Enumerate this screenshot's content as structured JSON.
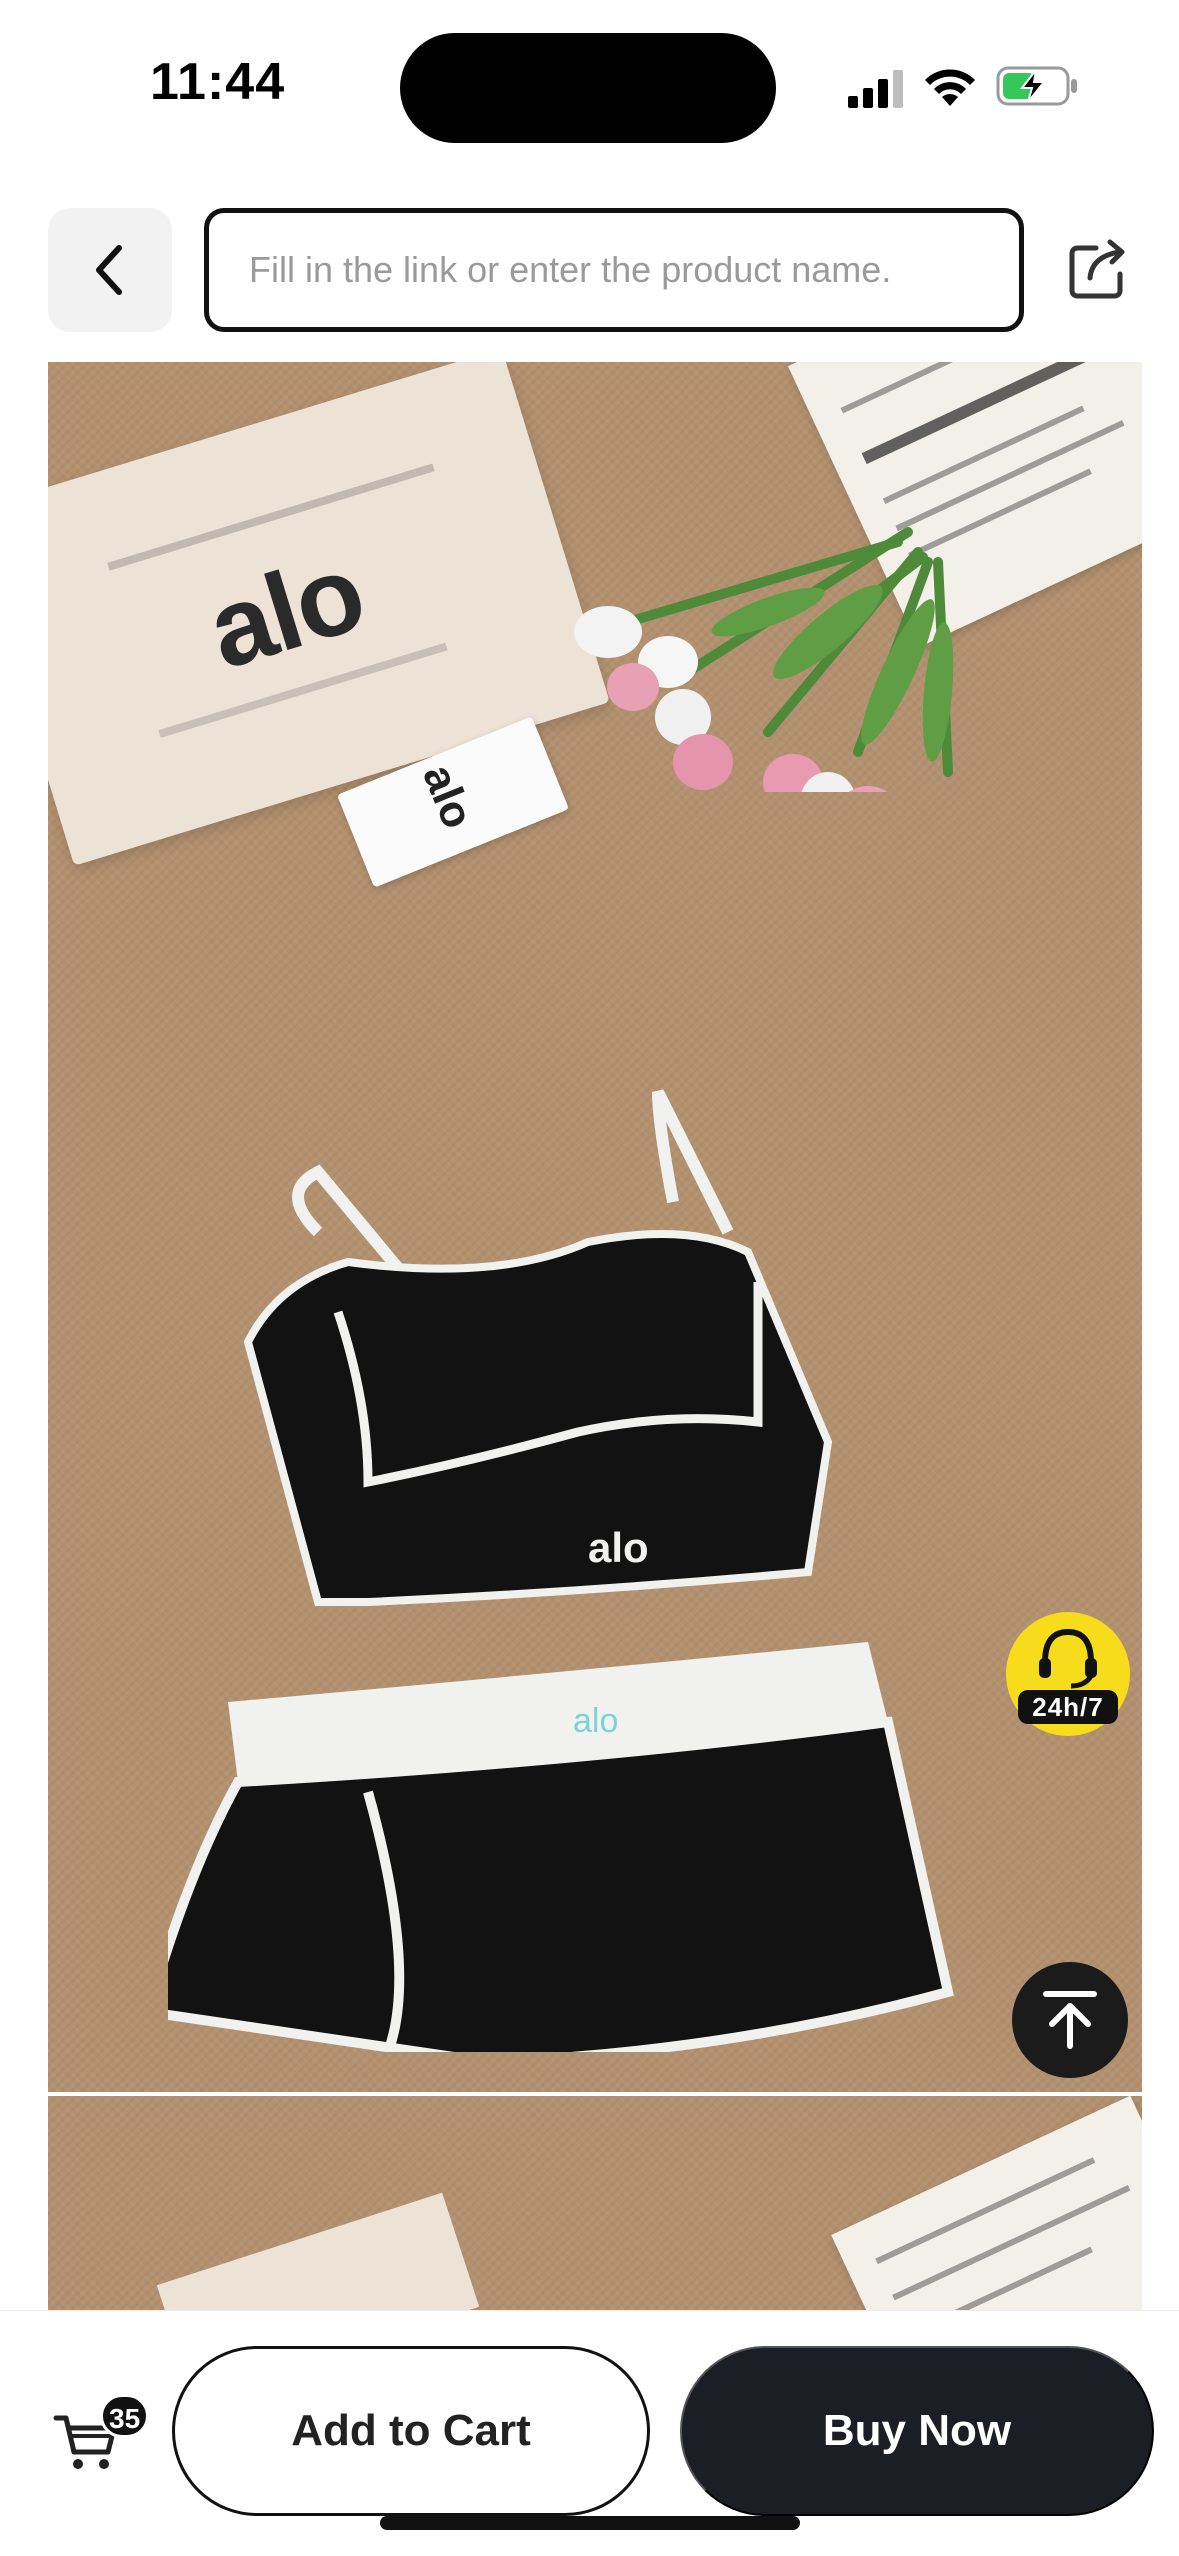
{
  "status_bar": {
    "time": "11:44",
    "icons": [
      "cellular-signal-icon",
      "wifi-icon",
      "battery-charging-icon"
    ]
  },
  "header": {
    "back_icon": "chevron-left-icon",
    "search_placeholder": "Fill in the link or enter the product name.",
    "search_value": "",
    "share_icon": "share-icon"
  },
  "product_images": {
    "main": {
      "bag_logo_text": "alo",
      "tag_logo_text": "alo",
      "top_logo_text": "alo",
      "skirt_logo_text": "alo"
    },
    "colors": {
      "background": "#b3916f",
      "garment": "#111111",
      "trim": "#f1f1ef"
    }
  },
  "floating": {
    "support_label": "24h/7",
    "support_icon": "headset-icon",
    "support_color": "#f7dc1b",
    "scroll_top_icon": "arrow-up-to-top-icon"
  },
  "bottom_bar": {
    "cart_icon": "shopping-cart-icon",
    "cart_count": "35",
    "add_to_cart_label": "Add to Cart",
    "buy_now_label": "Buy Now",
    "buy_now_color": "#1b1e24"
  }
}
